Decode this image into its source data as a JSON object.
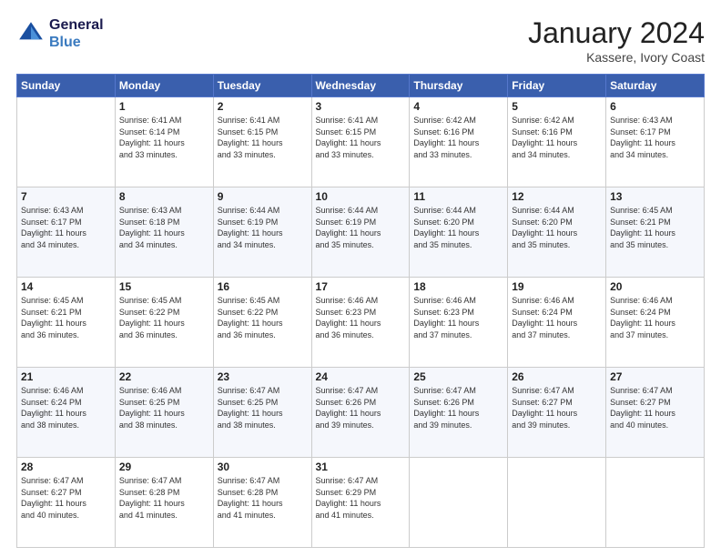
{
  "header": {
    "logo_line1": "General",
    "logo_line2": "Blue",
    "month": "January 2024",
    "location": "Kassere, Ivory Coast"
  },
  "weekdays": [
    "Sunday",
    "Monday",
    "Tuesday",
    "Wednesday",
    "Thursday",
    "Friday",
    "Saturday"
  ],
  "weeks": [
    [
      {
        "day": "",
        "info": ""
      },
      {
        "day": "1",
        "info": "Sunrise: 6:41 AM\nSunset: 6:14 PM\nDaylight: 11 hours\nand 33 minutes."
      },
      {
        "day": "2",
        "info": "Sunrise: 6:41 AM\nSunset: 6:15 PM\nDaylight: 11 hours\nand 33 minutes."
      },
      {
        "day": "3",
        "info": "Sunrise: 6:41 AM\nSunset: 6:15 PM\nDaylight: 11 hours\nand 33 minutes."
      },
      {
        "day": "4",
        "info": "Sunrise: 6:42 AM\nSunset: 6:16 PM\nDaylight: 11 hours\nand 33 minutes."
      },
      {
        "day": "5",
        "info": "Sunrise: 6:42 AM\nSunset: 6:16 PM\nDaylight: 11 hours\nand 34 minutes."
      },
      {
        "day": "6",
        "info": "Sunrise: 6:43 AM\nSunset: 6:17 PM\nDaylight: 11 hours\nand 34 minutes."
      }
    ],
    [
      {
        "day": "7",
        "info": "Sunrise: 6:43 AM\nSunset: 6:17 PM\nDaylight: 11 hours\nand 34 minutes."
      },
      {
        "day": "8",
        "info": "Sunrise: 6:43 AM\nSunset: 6:18 PM\nDaylight: 11 hours\nand 34 minutes."
      },
      {
        "day": "9",
        "info": "Sunrise: 6:44 AM\nSunset: 6:19 PM\nDaylight: 11 hours\nand 34 minutes."
      },
      {
        "day": "10",
        "info": "Sunrise: 6:44 AM\nSunset: 6:19 PM\nDaylight: 11 hours\nand 35 minutes."
      },
      {
        "day": "11",
        "info": "Sunrise: 6:44 AM\nSunset: 6:20 PM\nDaylight: 11 hours\nand 35 minutes."
      },
      {
        "day": "12",
        "info": "Sunrise: 6:44 AM\nSunset: 6:20 PM\nDaylight: 11 hours\nand 35 minutes."
      },
      {
        "day": "13",
        "info": "Sunrise: 6:45 AM\nSunset: 6:21 PM\nDaylight: 11 hours\nand 35 minutes."
      }
    ],
    [
      {
        "day": "14",
        "info": "Sunrise: 6:45 AM\nSunset: 6:21 PM\nDaylight: 11 hours\nand 36 minutes."
      },
      {
        "day": "15",
        "info": "Sunrise: 6:45 AM\nSunset: 6:22 PM\nDaylight: 11 hours\nand 36 minutes."
      },
      {
        "day": "16",
        "info": "Sunrise: 6:45 AM\nSunset: 6:22 PM\nDaylight: 11 hours\nand 36 minutes."
      },
      {
        "day": "17",
        "info": "Sunrise: 6:46 AM\nSunset: 6:23 PM\nDaylight: 11 hours\nand 36 minutes."
      },
      {
        "day": "18",
        "info": "Sunrise: 6:46 AM\nSunset: 6:23 PM\nDaylight: 11 hours\nand 37 minutes."
      },
      {
        "day": "19",
        "info": "Sunrise: 6:46 AM\nSunset: 6:24 PM\nDaylight: 11 hours\nand 37 minutes."
      },
      {
        "day": "20",
        "info": "Sunrise: 6:46 AM\nSunset: 6:24 PM\nDaylight: 11 hours\nand 37 minutes."
      }
    ],
    [
      {
        "day": "21",
        "info": "Sunrise: 6:46 AM\nSunset: 6:24 PM\nDaylight: 11 hours\nand 38 minutes."
      },
      {
        "day": "22",
        "info": "Sunrise: 6:46 AM\nSunset: 6:25 PM\nDaylight: 11 hours\nand 38 minutes."
      },
      {
        "day": "23",
        "info": "Sunrise: 6:47 AM\nSunset: 6:25 PM\nDaylight: 11 hours\nand 38 minutes."
      },
      {
        "day": "24",
        "info": "Sunrise: 6:47 AM\nSunset: 6:26 PM\nDaylight: 11 hours\nand 39 minutes."
      },
      {
        "day": "25",
        "info": "Sunrise: 6:47 AM\nSunset: 6:26 PM\nDaylight: 11 hours\nand 39 minutes."
      },
      {
        "day": "26",
        "info": "Sunrise: 6:47 AM\nSunset: 6:27 PM\nDaylight: 11 hours\nand 39 minutes."
      },
      {
        "day": "27",
        "info": "Sunrise: 6:47 AM\nSunset: 6:27 PM\nDaylight: 11 hours\nand 40 minutes."
      }
    ],
    [
      {
        "day": "28",
        "info": "Sunrise: 6:47 AM\nSunset: 6:27 PM\nDaylight: 11 hours\nand 40 minutes."
      },
      {
        "day": "29",
        "info": "Sunrise: 6:47 AM\nSunset: 6:28 PM\nDaylight: 11 hours\nand 41 minutes."
      },
      {
        "day": "30",
        "info": "Sunrise: 6:47 AM\nSunset: 6:28 PM\nDaylight: 11 hours\nand 41 minutes."
      },
      {
        "day": "31",
        "info": "Sunrise: 6:47 AM\nSunset: 6:29 PM\nDaylight: 11 hours\nand 41 minutes."
      },
      {
        "day": "",
        "info": ""
      },
      {
        "day": "",
        "info": ""
      },
      {
        "day": "",
        "info": ""
      }
    ]
  ]
}
